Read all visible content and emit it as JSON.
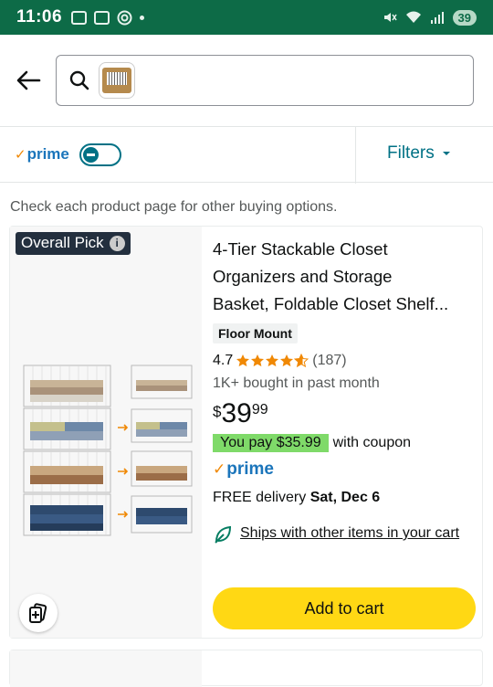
{
  "status_bar": {
    "time": "11:06",
    "battery": "39"
  },
  "filter_bar": {
    "prime_label": "prime",
    "filters_label": "Filters"
  },
  "notice": "Check each product page for other buying options.",
  "product": {
    "badge": "Overall Pick",
    "title_lines": [
      "4-Tier Stackable Closet",
      "Organizers and Storage",
      "Basket, Foldable Closet Shelf..."
    ],
    "tag": "Floor Mount",
    "rating": "4.7",
    "rating_stars_value": 4.7,
    "review_count": "(187)",
    "bought": "1K+ bought in past month",
    "price_symbol": "$",
    "price_whole": "39",
    "price_fraction": "99",
    "coupon_badge": "You pay $35.99",
    "coupon_text": "with coupon",
    "prime_label": "prime",
    "delivery_prefix": "FREE delivery ",
    "delivery_date": "Sat, Dec 6",
    "ships_text": "Ships with other items in your cart",
    "add_to_cart": "Add to cart"
  },
  "icons": {
    "back": "back-arrow-icon",
    "search": "search-icon",
    "compare": "compare-icon",
    "leaf": "leaf-icon",
    "info": "info-icon"
  },
  "colors": {
    "status_bar": "#0d6b47",
    "link": "#007185",
    "prime": "#1b75bb",
    "add_to_cart": "#ffd814",
    "coupon": "#7fda69",
    "badge": "#232f3e",
    "star": "#f08804"
  }
}
